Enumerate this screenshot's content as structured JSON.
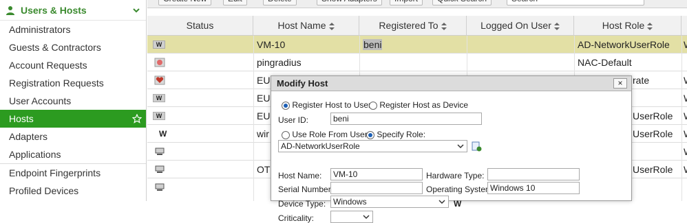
{
  "sidebar": {
    "section": "Users & Hosts",
    "items": [
      {
        "label": "Administrators"
      },
      {
        "label": "Guests & Contractors"
      },
      {
        "label": "Account Requests"
      },
      {
        "label": "Registration Requests"
      },
      {
        "label": "User Accounts"
      },
      {
        "label": "Hosts"
      },
      {
        "label": "Adapters"
      },
      {
        "label": "Applications"
      },
      {
        "label": "Endpoint Fingerprints"
      },
      {
        "label": "Profiled Devices"
      }
    ],
    "active_index": 5
  },
  "toolbar": {
    "buttons": [
      "Create New",
      "Edit",
      "Delete",
      "Show Adapters",
      "Import",
      "Quick Search"
    ],
    "search_placeholder": "Search"
  },
  "table": {
    "headers": [
      "Status",
      "Host Name",
      "Registered To",
      "Logged On User",
      "Host Role",
      "W"
    ],
    "rows": [
      {
        "status": "W",
        "host": "VM-10",
        "registered": "beni",
        "logged": "",
        "role": "AD-NetworkUserRole",
        "extra": "W"
      },
      {
        "status": "pin",
        "host": "pingradius",
        "registered": "",
        "logged": "",
        "role": "NAC-Default",
        "extra": ""
      },
      {
        "status": "heart",
        "host": "EU",
        "registered": "",
        "logged": "",
        "role": "rate",
        "extra": "W"
      },
      {
        "status": "W",
        "host": "EU",
        "registered": "",
        "logged": "",
        "role": "",
        "extra": "W"
      },
      {
        "status": "W",
        "host": "EU",
        "registered": "",
        "logged": "",
        "role": "UserRole",
        "extra": "W"
      },
      {
        "status": "W",
        "host": "wir",
        "registered": "",
        "logged": "",
        "role": "UserRole",
        "extra": "W"
      },
      {
        "status": "pc",
        "host": "",
        "registered": "",
        "logged": "",
        "role": "",
        "extra": "W"
      },
      {
        "status": "pc",
        "host": "OT",
        "registered": "",
        "logged": "",
        "role": "UserRole",
        "extra": "W"
      },
      {
        "status": "pc",
        "host": "",
        "registered": "",
        "logged": "",
        "role": "",
        "extra": ""
      }
    ]
  },
  "dialog": {
    "title": "Modify Host",
    "close": "×",
    "register_host_to_user": "Register Host to User",
    "register_host_as_device": "Register Host as Device",
    "user_id_label": "User ID:",
    "user_id_value": "beni",
    "use_role_from_user": "Use Role From User",
    "specify_role": "Specify Role:",
    "role_value": "AD-NetworkUserRole",
    "host_name_label": "Host Name:",
    "host_name_value": "VM-10",
    "hardware_type_label": "Hardware Type:",
    "hardware_type_value": "",
    "serial_number_label": "Serial Number:",
    "serial_number_value": "",
    "os_label": "Operating System:",
    "os_value": "Windows 10",
    "device_type_label": "Device Type:",
    "device_type_value": "Windows",
    "device_type_glyph": "W",
    "criticality_label": "Criticality:"
  },
  "colors": {
    "brand_green": "#2c9b20",
    "row_selected": "#e3e0a5"
  }
}
